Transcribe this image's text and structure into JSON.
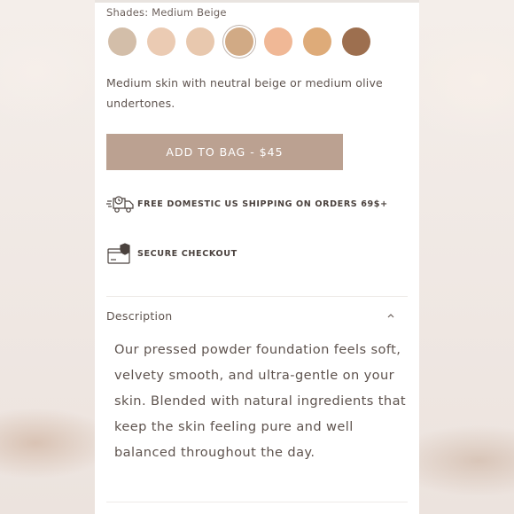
{
  "product": {
    "shades_label": "Shades: Medium Beige",
    "swatches": [
      {
        "name": "shade-1",
        "color": "#d3bea9",
        "selected": false
      },
      {
        "name": "shade-2",
        "color": "#ebcbb3",
        "selected": false
      },
      {
        "name": "shade-3",
        "color": "#e8c8ae",
        "selected": false
      },
      {
        "name": "shade-4",
        "color": "#d1aa85",
        "selected": true
      },
      {
        "name": "shade-5",
        "color": "#f0b896",
        "selected": false
      },
      {
        "name": "shade-6",
        "color": "#deab79",
        "selected": false
      },
      {
        "name": "shade-7",
        "color": "#9d6f4f",
        "selected": false
      }
    ],
    "shade_description": "Medium skin with neutral beige or medium olive undertones.",
    "add_to_bag_label": "ADD TO BAG - $45"
  },
  "features": {
    "shipping": {
      "icon": "delivery-truck-icon",
      "text": "FREE DOMESTIC US SHIPPING ON ORDERS 69$+"
    },
    "secure": {
      "icon": "secure-card-icon",
      "text": "SECURE CHECKOUT"
    }
  },
  "description": {
    "title": "Description",
    "expanded": true,
    "body": "Our pressed powder foundation feels soft, velvety smooth, and ultra-gentle on your skin. Blended with natural ingredients that keep the skin feeling pure and well balanced throughout the day."
  },
  "colors": {
    "button": "#bba191",
    "text": "#5e534e"
  }
}
